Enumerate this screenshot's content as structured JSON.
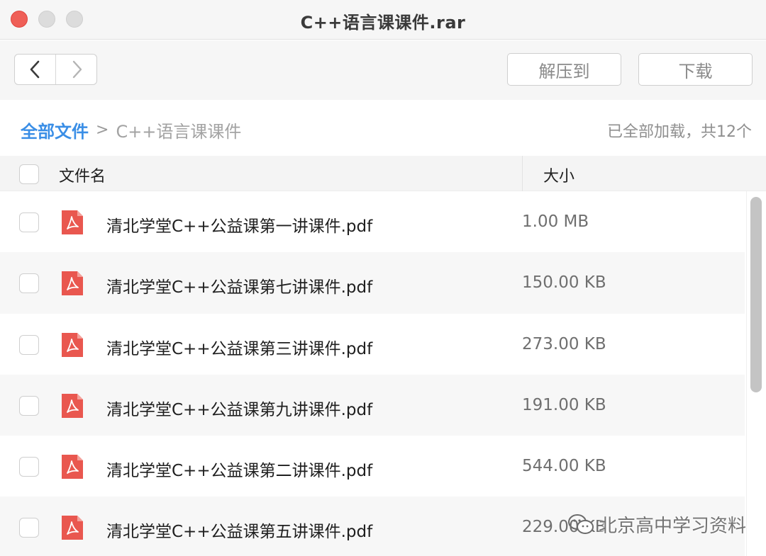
{
  "window": {
    "title": "C++语言课课件.rar"
  },
  "toolbar": {
    "back_icon": "chevron-left-icon",
    "forward_icon": "chevron-right-icon",
    "extract_label": "解压到",
    "download_label": "下载"
  },
  "path": {
    "root": "全部文件",
    "separator": ">",
    "current": "C++语言课课件",
    "status": "已全部加载，共12个"
  },
  "table": {
    "columns": {
      "name": "文件名",
      "size": "大小"
    },
    "rows": [
      {
        "name": "清北学堂C++公益课第一讲课件.pdf",
        "size": "1.00 MB"
      },
      {
        "name": "清北学堂C++公益课第七讲课件.pdf",
        "size": "150.00 KB"
      },
      {
        "name": "清北学堂C++公益课第三讲课件.pdf",
        "size": "273.00 KB"
      },
      {
        "name": "清北学堂C++公益课第九讲课件.pdf",
        "size": "191.00 KB"
      },
      {
        "name": "清北学堂C++公益课第二讲课件.pdf",
        "size": "544.00 KB"
      },
      {
        "name": "清北学堂C++公益课第五讲课件.pdf",
        "size": "229.00 KB"
      }
    ],
    "file_icon": "pdf-icon"
  },
  "watermark": {
    "text": "北京高中学习资料",
    "icon": "wechat-icon"
  },
  "colors": {
    "accent": "#3a8ee6",
    "pdf_red": "#e9574f",
    "close_red": "#ef5f57"
  }
}
